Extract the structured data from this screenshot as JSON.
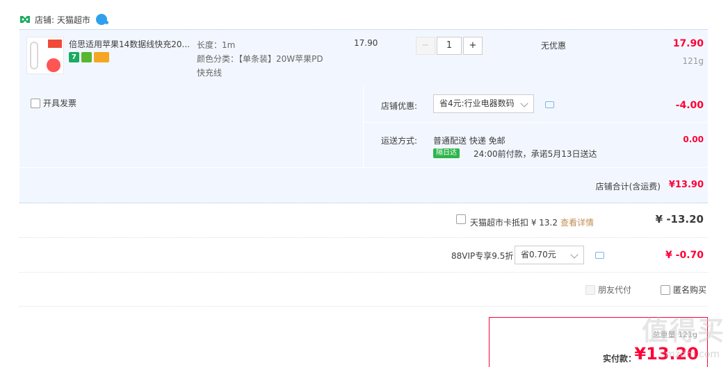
{
  "shop": {
    "label": "店铺: 天猫超市",
    "chat_badge": ""
  },
  "item": {
    "title": "倍思适用苹果14数据线快充20...",
    "length": "长度：1m",
    "color_label": "颜色分类：【单条装】20W苹果PD快充线",
    "unit_price": "17.90",
    "quantity": "1",
    "minus": "−",
    "plus": "+",
    "discount": "无优惠",
    "subtotal": "17.90",
    "weight": "121g",
    "badges": [
      "7",
      "",
      ""
    ]
  },
  "invoice": {
    "label": "开具发票"
  },
  "shop_promo": {
    "label": "店铺优惠:",
    "selected": "省4元:行业电器数码",
    "amount": "-4.00"
  },
  "shipping": {
    "label": "运送方式:",
    "method": "普通配送 快递 免邮",
    "tag": "隔日达",
    "promise": "24:00前付款，承诺5月13日送达",
    "amount": "0.00"
  },
  "shop_total": {
    "label": "店铺合计(含运费)",
    "amount": "¥13.90"
  },
  "card": {
    "label": "天猫超市卡抵扣 ¥ 13.2",
    "link": "查看详情",
    "amount": "¥ -13.20"
  },
  "vip": {
    "label": "88VIP专享9.5折",
    "selected": "省0.70元",
    "amount": "¥ -0.70"
  },
  "options": {
    "friend_pay": "朋友代付",
    "anonymous": "匿名购买"
  },
  "summary": {
    "weight": "总重量 121g",
    "label": "实付款：",
    "amount": "¥13.20"
  },
  "watermark": {
    "text": "值得买",
    "url": "smzdm.com"
  },
  "colors": {
    "accent": "#ff0036",
    "panel": "#f2f7ff",
    "link": "#c18d56"
  }
}
